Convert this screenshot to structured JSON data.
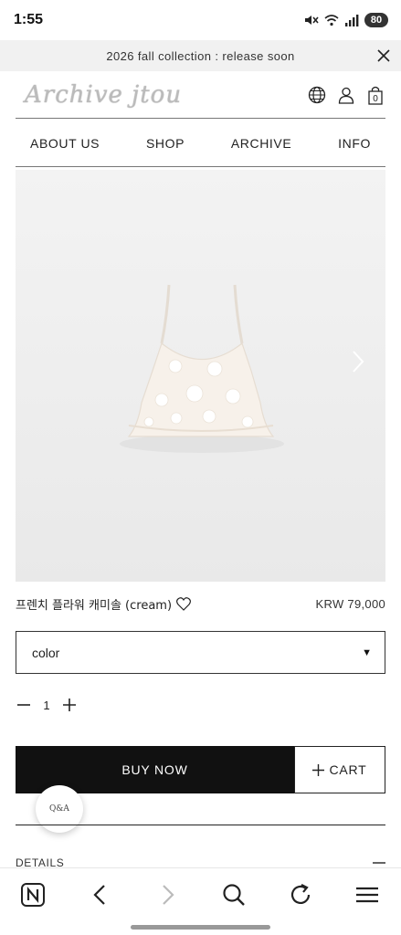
{
  "status_bar": {
    "time": "1:55",
    "battery": "80"
  },
  "announcement": {
    "text": "2026 fall collection : release soon"
  },
  "header": {
    "logo": "Archive jtou",
    "cart_count": "0"
  },
  "nav": {
    "items": [
      "ABOUT US",
      "SHOP",
      "ARCHIVE",
      "INFO"
    ]
  },
  "product": {
    "name": "프렌치 플라워 캐미솔 (cream)",
    "price": "KRW 79,000",
    "color_placeholder": "color",
    "quantity": "1"
  },
  "actions": {
    "buy_now": "BUY NOW",
    "cart": "CART"
  },
  "qa": {
    "label": "Q&A"
  },
  "details": {
    "label": "DETAILS"
  },
  "colors": {
    "accent": "#111111",
    "announce_bg": "#f1f1f1",
    "image_bg": "#eeeeee"
  }
}
